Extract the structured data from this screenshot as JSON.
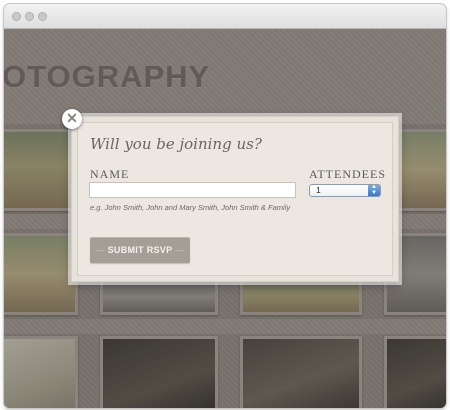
{
  "site": {
    "title": "OTOGRAPHY"
  },
  "modal": {
    "close_symbol": "✕",
    "title": "Will you be joining us?",
    "name_label": "NAME",
    "attendees_label": "ATTENDEES",
    "name_value": "",
    "name_hint": "e.g. John Smith, John and Mary Smith, John Smith & Family",
    "attendees_selected": "1",
    "select_arrow_up": "▲",
    "select_arrow_down": "▼",
    "submit_label": "SUBMIT RSVP"
  },
  "icons": {
    "close": "close-icon",
    "select_arrows": "up-down-arrows-icon"
  },
  "colors": {
    "page_bg": "#9c968f",
    "modal_bg": "#ece8e1",
    "submit_bg": "#a49e97",
    "select_accent": "#3b77c9"
  }
}
